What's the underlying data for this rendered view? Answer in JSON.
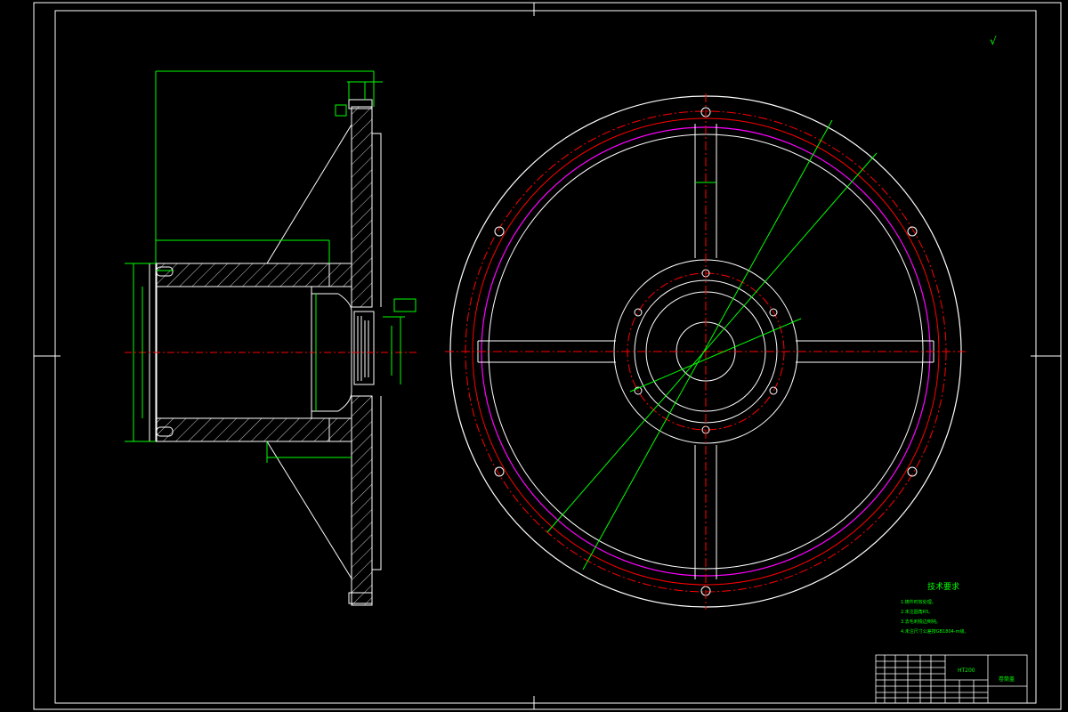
{
  "drawing": {
    "surface_finish": "√",
    "tech_requirements": {
      "title": "技术要求",
      "items": [
        "1.铸件时效处理。",
        "2.未注圆角R5。",
        "3.去毛刺锐边倒钝。",
        "4.未注尺寸公差按GB1804-m级。"
      ]
    },
    "title_block": {
      "material": "HT200",
      "part_name": "卷筒盖"
    }
  },
  "colors": {
    "background": "#000000",
    "frame": "#ffffff",
    "dimension": "#00ff00",
    "centerline": "#ff0000",
    "pitch_circle": "#ff00ff",
    "label_text": "#00ff00"
  }
}
